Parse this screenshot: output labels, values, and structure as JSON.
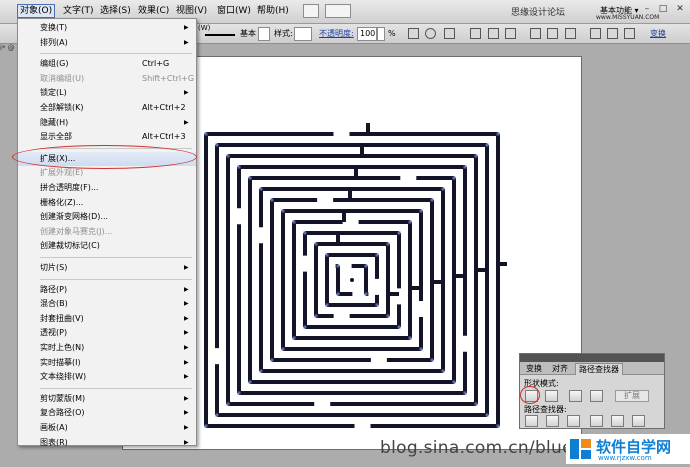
{
  "menubar": {
    "items": [
      "对象(O)",
      "文字(T)",
      "选择(S)",
      "效果(C)",
      "视图(V)",
      "窗口(W)",
      "帮助(H)"
    ],
    "site": "思缘设计论坛",
    "workspace": "基本功能 ▾",
    "url": "www.MISSYUAN.COM",
    "window_buttons": [
      "–",
      "□",
      "✕"
    ]
  },
  "controlbar": {
    "stroke_style": "基本",
    "style_label": "样式:",
    "opacity_label": "不透明度:",
    "opacity_value": "100",
    "opacity_unit": "%",
    "transform_link": "变换",
    "left_label": "(W)"
  },
  "document": {
    "tab_fragment": "i* @"
  },
  "object_menu": {
    "items": [
      {
        "label": "变换(T)",
        "shortcut": "",
        "submenu": true,
        "disabled": false
      },
      {
        "label": "排列(A)",
        "shortcut": "",
        "submenu": true,
        "disabled": false
      },
      {
        "label": "编组(G)",
        "shortcut": "Ctrl+G",
        "submenu": false,
        "disabled": false
      },
      {
        "label": "取消编组(U)",
        "shortcut": "Shift+Ctrl+G",
        "submenu": false,
        "disabled": true
      },
      {
        "label": "锁定(L)",
        "shortcut": "",
        "submenu": true,
        "disabled": false
      },
      {
        "label": "全部解锁(K)",
        "shortcut": "Alt+Ctrl+2",
        "submenu": false,
        "disabled": false
      },
      {
        "label": "隐藏(H)",
        "shortcut": "",
        "submenu": true,
        "disabled": false
      },
      {
        "label": "显示全部",
        "shortcut": "Alt+Ctrl+3",
        "submenu": false,
        "disabled": false
      },
      {
        "label": "扩展(X)...",
        "shortcut": "",
        "submenu": false,
        "disabled": false
      },
      {
        "label": "扩展外观(E)",
        "shortcut": "",
        "submenu": false,
        "disabled": true
      },
      {
        "label": "拼合透明度(F)...",
        "shortcut": "",
        "submenu": false,
        "disabled": false
      },
      {
        "label": "栅格化(Z)...",
        "shortcut": "",
        "submenu": false,
        "disabled": false
      },
      {
        "label": "创建渐变网格(D)...",
        "shortcut": "",
        "submenu": false,
        "disabled": false
      },
      {
        "label": "创建对象马赛克(J)...",
        "shortcut": "",
        "submenu": false,
        "disabled": true
      },
      {
        "label": "创建裁切标记(C)",
        "shortcut": "",
        "submenu": false,
        "disabled": false
      },
      {
        "label": "切片(S)",
        "shortcut": "",
        "submenu": true,
        "disabled": false
      },
      {
        "label": "路径(P)",
        "shortcut": "",
        "submenu": true,
        "disabled": false
      },
      {
        "label": "混合(B)",
        "shortcut": "",
        "submenu": true,
        "disabled": false
      },
      {
        "label": "封套扭曲(V)",
        "shortcut": "",
        "submenu": true,
        "disabled": false
      },
      {
        "label": "透视(P)",
        "shortcut": "",
        "submenu": true,
        "disabled": false
      },
      {
        "label": "实时上色(N)",
        "shortcut": "",
        "submenu": true,
        "disabled": false
      },
      {
        "label": "实时描摹(I)",
        "shortcut": "",
        "submenu": true,
        "disabled": false
      },
      {
        "label": "文本绕排(W)",
        "shortcut": "",
        "submenu": true,
        "disabled": false
      },
      {
        "label": "剪切蒙版(M)",
        "shortcut": "",
        "submenu": true,
        "disabled": false
      },
      {
        "label": "复合路径(O)",
        "shortcut": "",
        "submenu": true,
        "disabled": false
      },
      {
        "label": "画板(A)",
        "shortcut": "",
        "submenu": true,
        "disabled": false
      },
      {
        "label": "图表(R)",
        "shortcut": "",
        "submenu": true,
        "disabled": false
      }
    ]
  },
  "pathfinder_panel": {
    "tabs": [
      "变换",
      "对齐",
      "路径查找器"
    ],
    "shape_modes_label": "形状模式:",
    "expand_label": "扩展",
    "pathfinders_label": "路径查找器:"
  },
  "watermark": {
    "text": "blog.sina.com.cn/bluequeen",
    "brand": "软件自学网",
    "url": "www.rjzxw.com"
  }
}
